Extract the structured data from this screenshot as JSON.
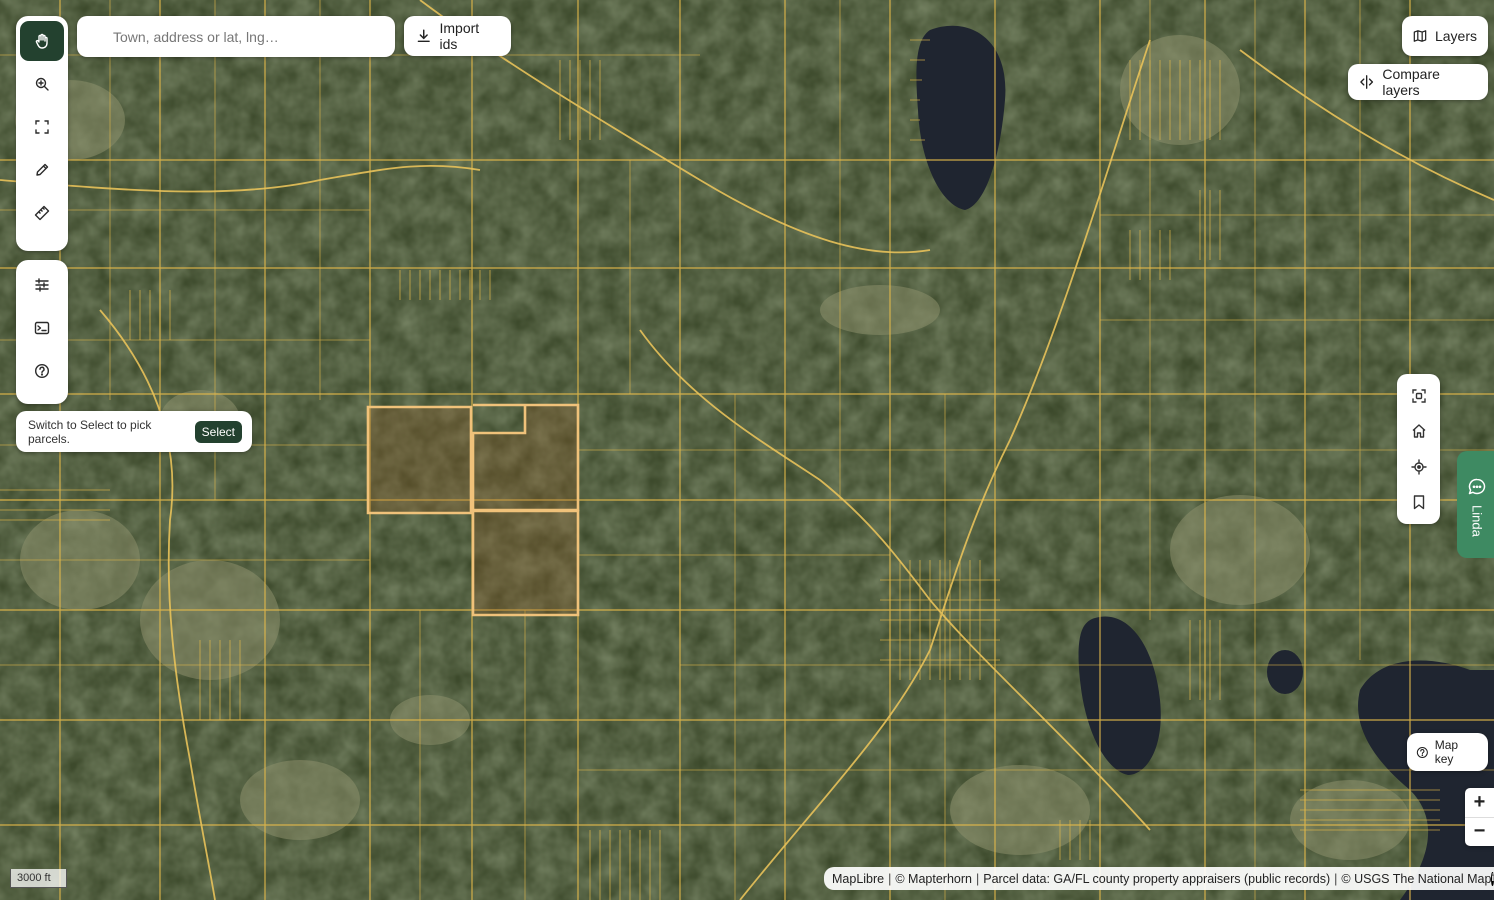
{
  "search": {
    "placeholder": "Town, address or lat, lng…"
  },
  "import_button": {
    "label": "Import ids"
  },
  "layers_button": {
    "label": "Layers"
  },
  "compare_button": {
    "label": "Compare layers"
  },
  "hint": {
    "text": "Switch to Select to pick parcels.",
    "button": "Select"
  },
  "map_key": {
    "label": "Map key"
  },
  "chat": {
    "label": "Linda"
  },
  "zoom": {
    "in": "+",
    "out": "−"
  },
  "scale": {
    "label": "3000 ft"
  },
  "attribution": {
    "maplibre": "MapLibre",
    "mapterhorn": "© Mapterhorn",
    "parcels": "Parcel data: GA/FL county property appraisers (public records)",
    "usgs": "© USGS The National Map"
  },
  "toolbar_top": [
    {
      "name": "pan-hand-icon",
      "active": true
    },
    {
      "name": "zoom-search-icon",
      "active": false
    },
    {
      "name": "select-area-icon",
      "active": false
    },
    {
      "name": "draw-pencil-icon",
      "active": false
    },
    {
      "name": "measure-ruler-icon",
      "active": false
    }
  ],
  "toolbar_bottom": [
    {
      "name": "list-icon"
    },
    {
      "name": "console-icon"
    },
    {
      "name": "help-icon"
    }
  ],
  "right_tools": [
    {
      "name": "fit-bounds-icon"
    },
    {
      "name": "home-icon"
    },
    {
      "name": "locate-icon"
    },
    {
      "name": "bookmark-icon"
    }
  ],
  "colors": {
    "accent": "#23412f",
    "parcel_line": "#e2b84a",
    "selected_parcel": "#f0c27a",
    "chat": "#3e8a62",
    "water": "#1f2530"
  }
}
